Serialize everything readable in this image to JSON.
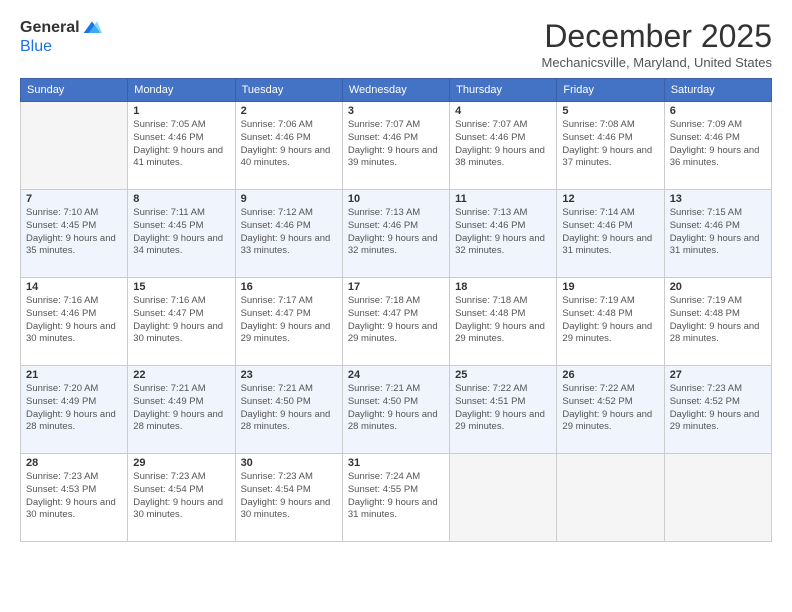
{
  "header": {
    "logo_general": "General",
    "logo_blue": "Blue",
    "month": "December 2025",
    "location": "Mechanicsville, Maryland, United States"
  },
  "days_of_week": [
    "Sunday",
    "Monday",
    "Tuesday",
    "Wednesday",
    "Thursday",
    "Friday",
    "Saturday"
  ],
  "weeks": [
    [
      {
        "day": "",
        "empty": true
      },
      {
        "day": "1",
        "sunrise": "Sunrise: 7:05 AM",
        "sunset": "Sunset: 4:46 PM",
        "daylight": "Daylight: 9 hours and 41 minutes."
      },
      {
        "day": "2",
        "sunrise": "Sunrise: 7:06 AM",
        "sunset": "Sunset: 4:46 PM",
        "daylight": "Daylight: 9 hours and 40 minutes."
      },
      {
        "day": "3",
        "sunrise": "Sunrise: 7:07 AM",
        "sunset": "Sunset: 4:46 PM",
        "daylight": "Daylight: 9 hours and 39 minutes."
      },
      {
        "day": "4",
        "sunrise": "Sunrise: 7:07 AM",
        "sunset": "Sunset: 4:46 PM",
        "daylight": "Daylight: 9 hours and 38 minutes."
      },
      {
        "day": "5",
        "sunrise": "Sunrise: 7:08 AM",
        "sunset": "Sunset: 4:46 PM",
        "daylight": "Daylight: 9 hours and 37 minutes."
      },
      {
        "day": "6",
        "sunrise": "Sunrise: 7:09 AM",
        "sunset": "Sunset: 4:46 PM",
        "daylight": "Daylight: 9 hours and 36 minutes."
      }
    ],
    [
      {
        "day": "7",
        "sunrise": "Sunrise: 7:10 AM",
        "sunset": "Sunset: 4:45 PM",
        "daylight": "Daylight: 9 hours and 35 minutes."
      },
      {
        "day": "8",
        "sunrise": "Sunrise: 7:11 AM",
        "sunset": "Sunset: 4:45 PM",
        "daylight": "Daylight: 9 hours and 34 minutes."
      },
      {
        "day": "9",
        "sunrise": "Sunrise: 7:12 AM",
        "sunset": "Sunset: 4:46 PM",
        "daylight": "Daylight: 9 hours and 33 minutes."
      },
      {
        "day": "10",
        "sunrise": "Sunrise: 7:13 AM",
        "sunset": "Sunset: 4:46 PM",
        "daylight": "Daylight: 9 hours and 32 minutes."
      },
      {
        "day": "11",
        "sunrise": "Sunrise: 7:13 AM",
        "sunset": "Sunset: 4:46 PM",
        "daylight": "Daylight: 9 hours and 32 minutes."
      },
      {
        "day": "12",
        "sunrise": "Sunrise: 7:14 AM",
        "sunset": "Sunset: 4:46 PM",
        "daylight": "Daylight: 9 hours and 31 minutes."
      },
      {
        "day": "13",
        "sunrise": "Sunrise: 7:15 AM",
        "sunset": "Sunset: 4:46 PM",
        "daylight": "Daylight: 9 hours and 31 minutes."
      }
    ],
    [
      {
        "day": "14",
        "sunrise": "Sunrise: 7:16 AM",
        "sunset": "Sunset: 4:46 PM",
        "daylight": "Daylight: 9 hours and 30 minutes."
      },
      {
        "day": "15",
        "sunrise": "Sunrise: 7:16 AM",
        "sunset": "Sunset: 4:47 PM",
        "daylight": "Daylight: 9 hours and 30 minutes."
      },
      {
        "day": "16",
        "sunrise": "Sunrise: 7:17 AM",
        "sunset": "Sunset: 4:47 PM",
        "daylight": "Daylight: 9 hours and 29 minutes."
      },
      {
        "day": "17",
        "sunrise": "Sunrise: 7:18 AM",
        "sunset": "Sunset: 4:47 PM",
        "daylight": "Daylight: 9 hours and 29 minutes."
      },
      {
        "day": "18",
        "sunrise": "Sunrise: 7:18 AM",
        "sunset": "Sunset: 4:48 PM",
        "daylight": "Daylight: 9 hours and 29 minutes."
      },
      {
        "day": "19",
        "sunrise": "Sunrise: 7:19 AM",
        "sunset": "Sunset: 4:48 PM",
        "daylight": "Daylight: 9 hours and 29 minutes."
      },
      {
        "day": "20",
        "sunrise": "Sunrise: 7:19 AM",
        "sunset": "Sunset: 4:48 PM",
        "daylight": "Daylight: 9 hours and 28 minutes."
      }
    ],
    [
      {
        "day": "21",
        "sunrise": "Sunrise: 7:20 AM",
        "sunset": "Sunset: 4:49 PM",
        "daylight": "Daylight: 9 hours and 28 minutes."
      },
      {
        "day": "22",
        "sunrise": "Sunrise: 7:21 AM",
        "sunset": "Sunset: 4:49 PM",
        "daylight": "Daylight: 9 hours and 28 minutes."
      },
      {
        "day": "23",
        "sunrise": "Sunrise: 7:21 AM",
        "sunset": "Sunset: 4:50 PM",
        "daylight": "Daylight: 9 hours and 28 minutes."
      },
      {
        "day": "24",
        "sunrise": "Sunrise: 7:21 AM",
        "sunset": "Sunset: 4:50 PM",
        "daylight": "Daylight: 9 hours and 28 minutes."
      },
      {
        "day": "25",
        "sunrise": "Sunrise: 7:22 AM",
        "sunset": "Sunset: 4:51 PM",
        "daylight": "Daylight: 9 hours and 29 minutes."
      },
      {
        "day": "26",
        "sunrise": "Sunrise: 7:22 AM",
        "sunset": "Sunset: 4:52 PM",
        "daylight": "Daylight: 9 hours and 29 minutes."
      },
      {
        "day": "27",
        "sunrise": "Sunrise: 7:23 AM",
        "sunset": "Sunset: 4:52 PM",
        "daylight": "Daylight: 9 hours and 29 minutes."
      }
    ],
    [
      {
        "day": "28",
        "sunrise": "Sunrise: 7:23 AM",
        "sunset": "Sunset: 4:53 PM",
        "daylight": "Daylight: 9 hours and 30 minutes."
      },
      {
        "day": "29",
        "sunrise": "Sunrise: 7:23 AM",
        "sunset": "Sunset: 4:54 PM",
        "daylight": "Daylight: 9 hours and 30 minutes."
      },
      {
        "day": "30",
        "sunrise": "Sunrise: 7:23 AM",
        "sunset": "Sunset: 4:54 PM",
        "daylight": "Daylight: 9 hours and 30 minutes."
      },
      {
        "day": "31",
        "sunrise": "Sunrise: 7:24 AM",
        "sunset": "Sunset: 4:55 PM",
        "daylight": "Daylight: 9 hours and 31 minutes."
      },
      {
        "day": "",
        "empty": true
      },
      {
        "day": "",
        "empty": true
      },
      {
        "day": "",
        "empty": true
      }
    ]
  ]
}
